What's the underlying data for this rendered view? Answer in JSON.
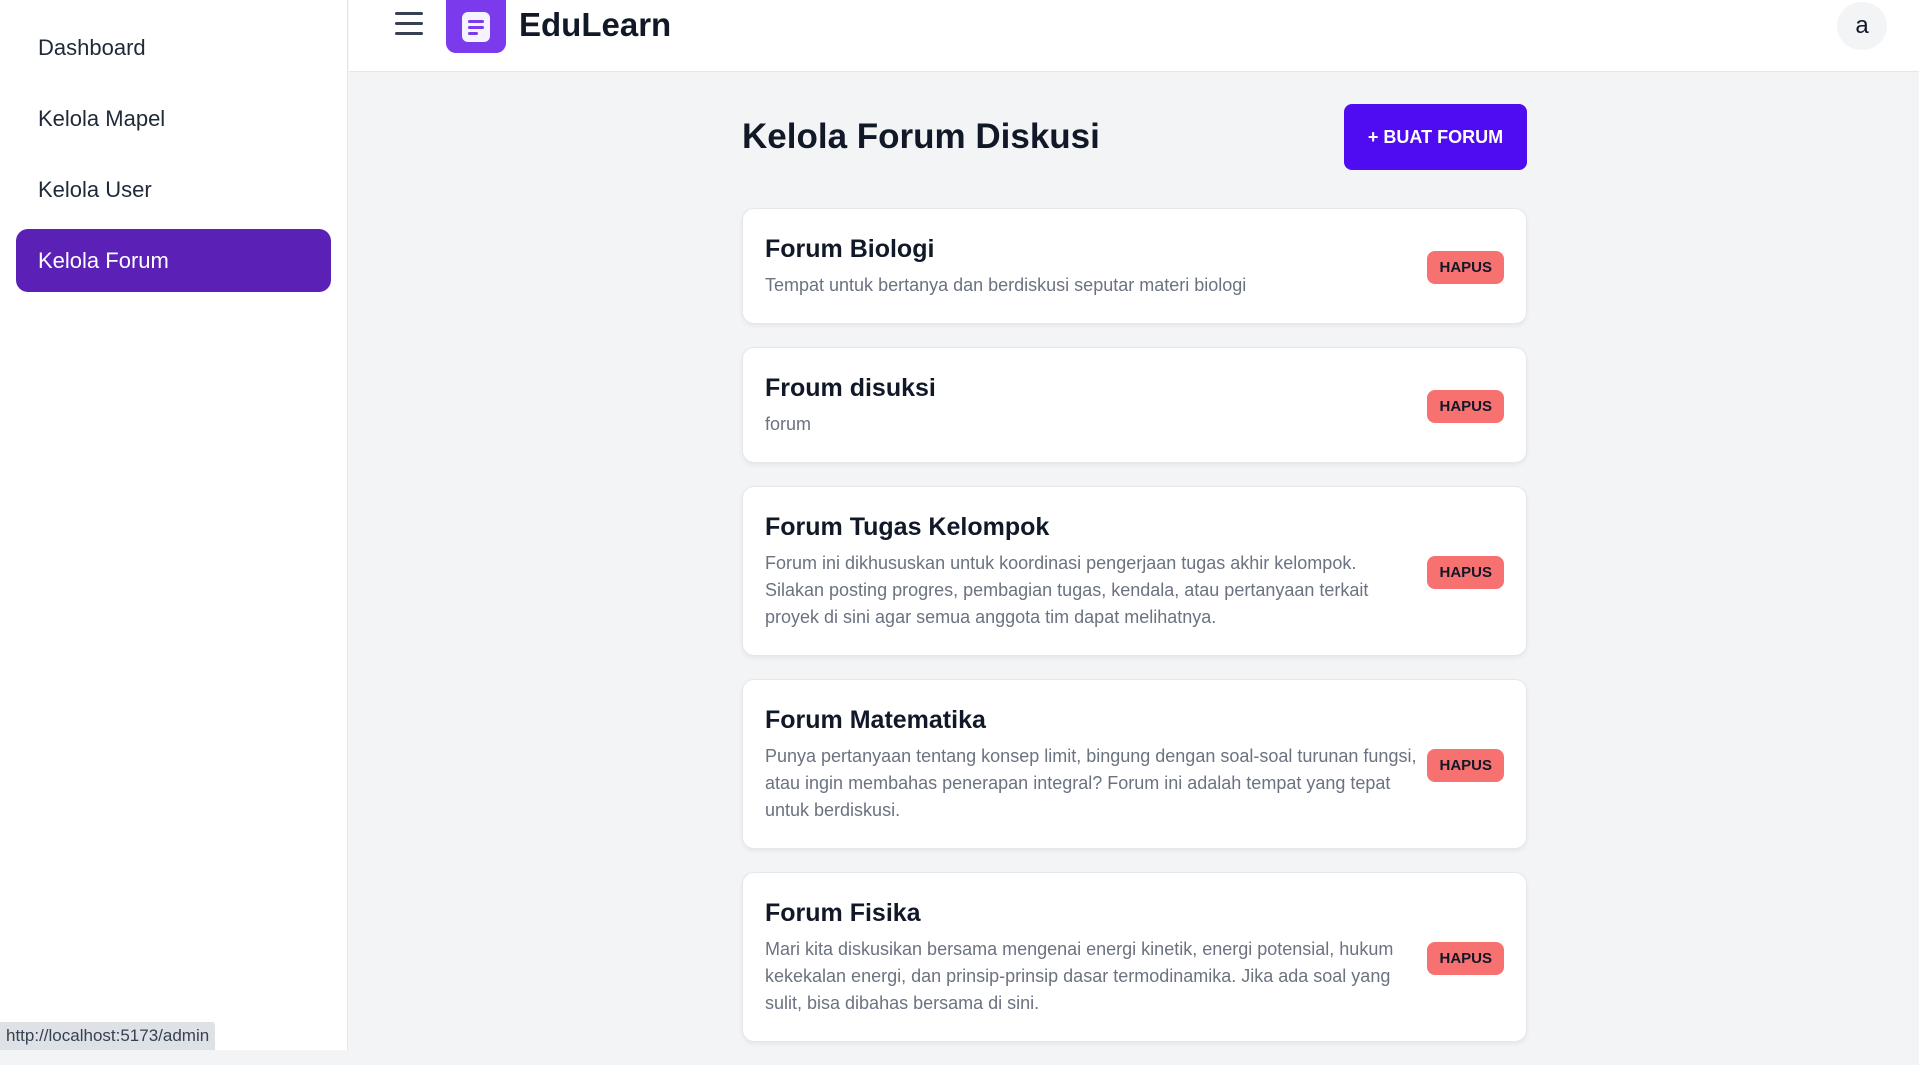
{
  "sidebar": {
    "items": [
      {
        "label": "Dashboard"
      },
      {
        "label": "Kelola Mapel"
      },
      {
        "label": "Kelola User"
      },
      {
        "label": "Kelola Forum"
      }
    ]
  },
  "header": {
    "brand": "EduLearn",
    "avatar_initial": "a",
    "menu_icon": "hamburger-menu-icon",
    "logo_icon": "document-logo-icon"
  },
  "main": {
    "title": "Kelola Forum Diskusi",
    "create_button": "+ BUAT FORUM",
    "forums": [
      {
        "title": "Forum Biologi",
        "description": "Tempat untuk bertanya dan berdiskusi seputar materi biologi",
        "delete_label": "HAPUS"
      },
      {
        "title": "Froum disuksi",
        "description": "forum",
        "delete_label": "HAPUS"
      },
      {
        "title": "Forum Tugas Kelompok",
        "description": "Forum ini dikhususkan untuk koordinasi pengerjaan tugas akhir kelompok. Silakan posting progres, pembagian tugas, kendala, atau pertanyaan terkait proyek di sini agar semua anggota tim dapat melihatnya.",
        "delete_label": "HAPUS"
      },
      {
        "title": "Forum Matematika",
        "description": "Punya pertanyaan tentang konsep limit, bingung dengan soal-soal turunan fungsi, atau ingin membahas penerapan integral? Forum ini adalah tempat yang tepat untuk berdiskusi.",
        "delete_label": "HAPUS"
      },
      {
        "title": "Forum Fisika",
        "description": "Mari kita diskusikan bersama mengenai energi kinetik, energi potensial, hukum kekekalan energi, dan prinsip-prinsip dasar termodinamika. Jika ada soal yang sulit, bisa dibahas bersama di sini.",
        "delete_label": "HAPUS"
      }
    ]
  },
  "status_bar": {
    "url": "http://localhost:5173/admin"
  },
  "colors": {
    "accent": "#5b21b6",
    "primary_button": "#4f0cf0",
    "danger": "#f87171",
    "logo": "#7c3aed"
  }
}
